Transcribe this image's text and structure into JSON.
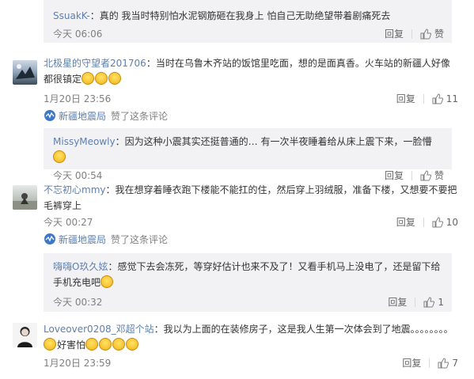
{
  "comments": [
    {
      "kind": "reply",
      "user": "SsuakK-",
      "text": "：真的  我当时特别怕水泥钢筋砸在我身上 怕自己无助绝望带着剧痛死去",
      "time": "今天 06:06",
      "reply_label": "回复",
      "like_label": "赞"
    },
    {
      "kind": "comment",
      "user": "北极星的守望者201706",
      "text": "：当时在乌鲁木齐站的饭馆里吃面，想的是面真香。火车站的新疆人好像都很镇定",
      "time": "1月20日 23:56",
      "reply_label": "回复",
      "like_count": "11",
      "liked_source": "新疆地震局",
      "liked_text": "赞了这条评论"
    },
    {
      "kind": "reply",
      "user": "MissyMeowly",
      "text": "：因为这种小震其实还挺普通的…  有一次半夜睡着给从床上震下来，一脸懵",
      "time": "今天 00:54",
      "reply_label": "回复",
      "like_label": "赞"
    },
    {
      "kind": "comment",
      "user": "不忘初心mmy",
      "text": "：我在想穿着睡衣跑下楼能不能扛的住，然后穿上羽绒服，准备下楼，又想要不要把毛裤穿上",
      "time": "今天 00:27",
      "reply_label": "回复",
      "like_count": "10",
      "liked_source": "新疆地震局",
      "liked_text": "赞了这条评论"
    },
    {
      "kind": "reply",
      "user": "嗨嗨O玖久妶",
      "text": "：感觉下去会冻死，等穿好估计也来不及了！又看手机马上没电了，还是留下给手机充电吧",
      "time": "今天 00:32",
      "reply_label": "回复",
      "like_count": "1"
    },
    {
      "kind": "comment",
      "user": "Loveover0208_邓超个站",
      "text": "：我以为上面的在装修房子，这是我人生第一次体会到了地震。。。。。。。。",
      "text2": "好害怕",
      "time": "1月20日 23:59",
      "reply_label": "回复",
      "like_count": "7"
    }
  ],
  "colors": {
    "username": "#eb7350",
    "reply_bg": "#f2f2f5",
    "time": "#808080"
  }
}
